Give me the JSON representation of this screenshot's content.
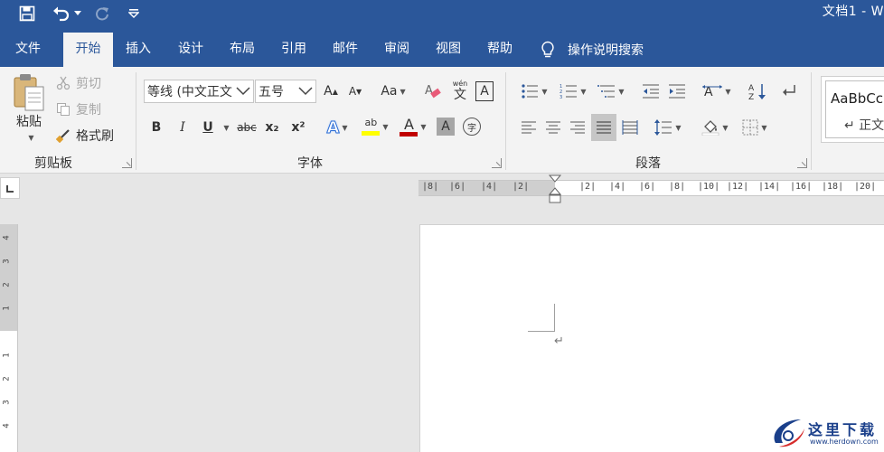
{
  "window": {
    "title": "文档1  -  W"
  },
  "tabs": [
    {
      "label": "文件"
    },
    {
      "label": "开始"
    },
    {
      "label": "插入"
    },
    {
      "label": "设计"
    },
    {
      "label": "布局"
    },
    {
      "label": "引用"
    },
    {
      "label": "邮件"
    },
    {
      "label": "审阅"
    },
    {
      "label": "视图"
    },
    {
      "label": "帮助"
    }
  ],
  "active_tab": "开始",
  "tell_me": {
    "label": "操作说明搜索"
  },
  "clipboard": {
    "paste_label": "粘贴",
    "cut_label": "剪切",
    "copy_label": "复制",
    "format_painter_label": "格式刷",
    "group_label": "剪贴板"
  },
  "font": {
    "font_name": "等线 (中文正文",
    "font_size": "五号",
    "group_label": "字体",
    "grow_label": "A",
    "shrink_label": "A",
    "case_label": "Aa",
    "phonetic_top": "wén",
    "phonetic_char": "文",
    "border_char": "A",
    "bold_label": "B",
    "italic_label": "I",
    "underline_label": "U",
    "strike_label": "abc",
    "subscript_label": "x₂",
    "superscript_label": "x²",
    "effects_label": "A",
    "highlight_label": "ab",
    "font_color_label": "A",
    "shading_label": "A",
    "enclose_label": "字",
    "highlight_color": "#ffff00",
    "font_color": "#c00000"
  },
  "paragraph": {
    "group_label": "段落"
  },
  "styles": {
    "preview": "AaBbCcI",
    "normal_label": "↵ 正文"
  },
  "h_ruler": {
    "left_ticks": [
      "8",
      "6",
      "4",
      "2"
    ],
    "right_ticks": [
      "2",
      "4",
      "6",
      "8",
      "10",
      "12",
      "14",
      "16",
      "18",
      "20"
    ]
  },
  "v_ruler": {
    "upper_ticks": [
      "4",
      "3",
      "2",
      "1"
    ],
    "lower_ticks": [
      "1",
      "2",
      "3",
      "4"
    ]
  },
  "document": {
    "paragraph_mark": "↵"
  },
  "watermark": {
    "text": "这里下载",
    "url": "www.herdown.com"
  },
  "colors": {
    "title_bar": "#2b579a",
    "ribbon": "#f3f3f3",
    "workspace": "#e6e6e6"
  }
}
